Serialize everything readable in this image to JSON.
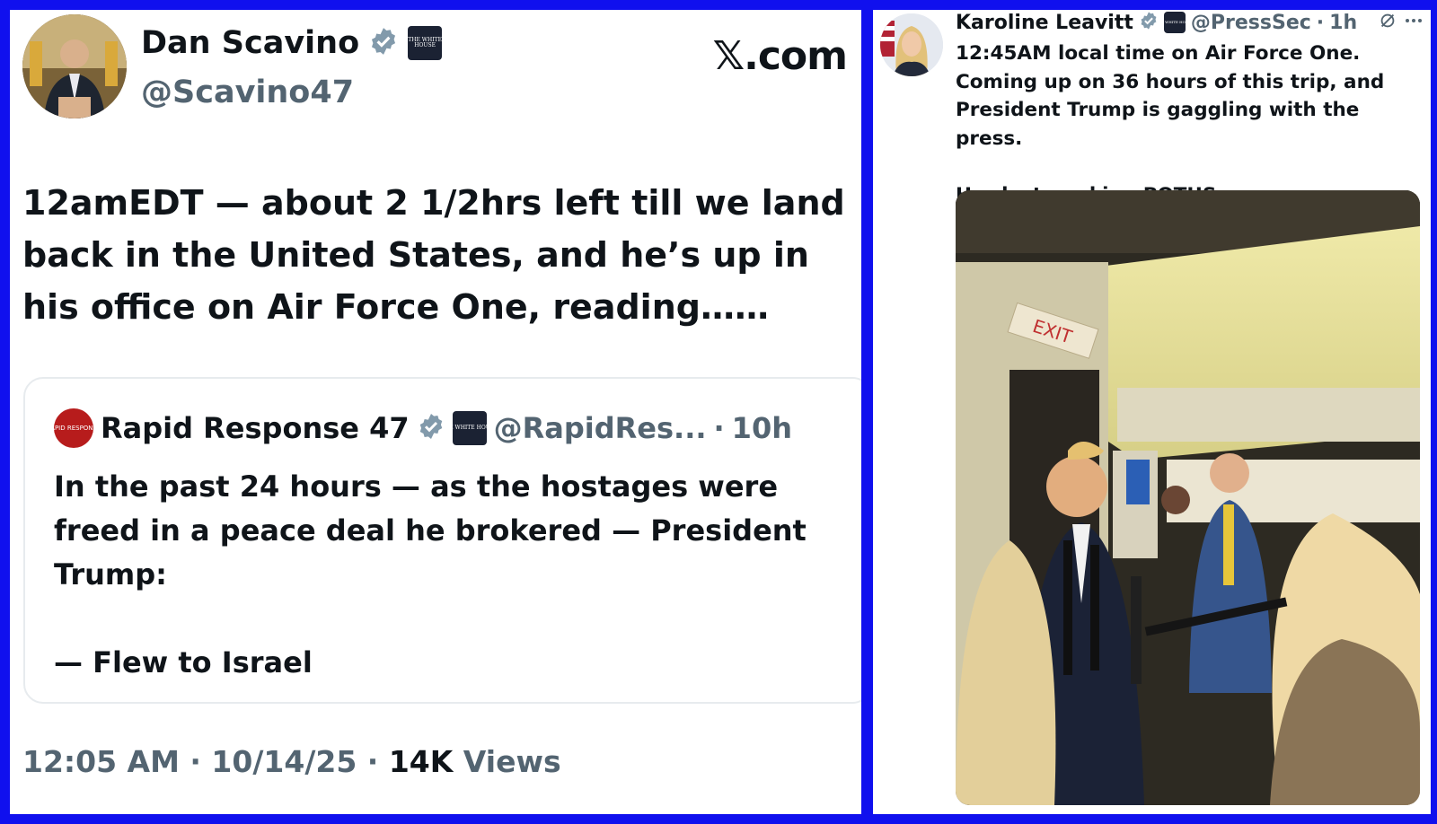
{
  "left_tweet": {
    "author_name": "Dan Scavino",
    "author_handle": "@Scavino47",
    "author_badge_text": "THE WHITE HOUSE",
    "site_logo": "𝕏.com",
    "text": "12amEDT — about 2 1/2hrs left till we land back in the United States, and he’s up in his office on Air Force One, reading……",
    "quote": {
      "avatar_text": "RAPID RESPONSE",
      "name": "Rapid Response 47",
      "badge_text": "THE WHITE HOUSE",
      "handle": "@RapidRes...",
      "dot": "·",
      "time": "10h",
      "text": "In the past 24 hours — as the hostages were freed in a peace deal he brokered — President Trump:\n\n— Flew to Israel"
    },
    "timestamp": "12:05 AM · 10/14/25 · ",
    "views_count": "14K",
    "views_label": " Views"
  },
  "right_tweet": {
    "author_name": "Karoline Leavitt",
    "badge_text": "THE WHITE HOUSE",
    "handle": "@PressSec",
    "dot": "·",
    "time": "1h",
    "text": "12:45AM local time on Air Force One. Coming up on 36 hours of this trip, and President Trump is gaggling with the press.\n\nHardest working POTUS ever.",
    "photo_sign_text": "EXIT"
  },
  "colors": {
    "frame": "#1010ee",
    "verified": "#829aab",
    "text_primary": "#0f1419",
    "text_secondary": "#536471"
  },
  "icons": [
    "verified-badge-icon",
    "white-house-badge-icon",
    "grok-icon",
    "more-options-icon"
  ]
}
